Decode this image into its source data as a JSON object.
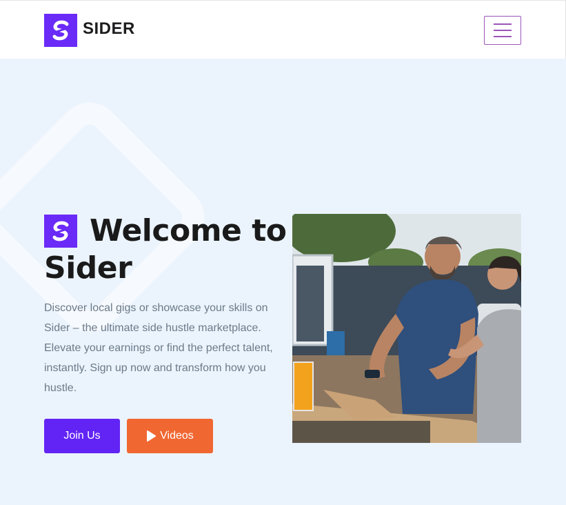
{
  "header": {
    "brand": "SIDER",
    "logo_icon": "sider-s-logo-icon",
    "menu_icon": "hamburger-menu-icon"
  },
  "hero": {
    "title_line1": "Welcome to",
    "title_line2": "Sider",
    "description": "Discover local gigs or showcase your skills on Sider – the ultimate side hustle marketplace. Elevate your earnings or find the perfect talent, instantly. Sign up now and transform how you hustle.",
    "join_label": "Join Us",
    "videos_label": "Videos",
    "videos_icon": "play-icon"
  },
  "colors": {
    "brand": "#6a2af7",
    "join_button": "#6223f5",
    "videos_button": "#f06732",
    "hero_background": "#ebf4fd",
    "menu_border": "#9a55b8"
  }
}
